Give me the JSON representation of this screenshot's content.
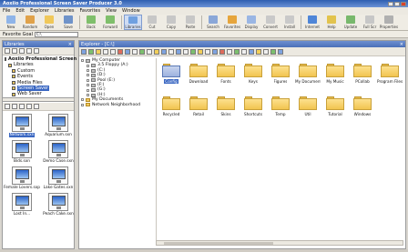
{
  "window": {
    "title": "Aoxiio Professional Screen Saver Producer 3.0"
  },
  "menu": [
    "File",
    "Edit",
    "Explorer",
    "Libraries",
    "Favorites",
    "View",
    "Window"
  ],
  "toolbar": [
    {
      "label": "New",
      "color": "#8fb4e8"
    },
    {
      "label": "Random",
      "color": "#e0a24a"
    },
    {
      "label": "Open",
      "color": "#f0c85a"
    },
    {
      "label": "Save",
      "color": "#6f93c9"
    },
    {
      "label": "Back",
      "color": "#7fbf6b"
    },
    {
      "label": "Forward",
      "color": "#7fbf6b"
    },
    {
      "label": "Libraries",
      "color": "#6fa0e0",
      "active": true
    },
    {
      "label": "Cut",
      "color": "#c7c7c7"
    },
    {
      "label": "Copy",
      "color": "#c7c7c7"
    },
    {
      "label": "Paste",
      "color": "#c7c7c7"
    },
    {
      "label": "Search",
      "color": "#8aa7d8"
    },
    {
      "label": "Favorites",
      "color": "#e6a53c"
    },
    {
      "label": "Display",
      "color": "#9ab6e4"
    },
    {
      "label": "Convert",
      "color": "#c9c9c9"
    },
    {
      "label": "Install",
      "color": "#c9c9c9"
    },
    {
      "label": "Internet",
      "color": "#4f86d8"
    },
    {
      "label": "Help",
      "color": "#e2c34d"
    },
    {
      "label": "Update",
      "color": "#78b86c"
    },
    {
      "label": "Full Scr",
      "color": "#c7c7c7"
    },
    {
      "label": "Properties",
      "color": "#b0b0b0"
    }
  ],
  "address": {
    "label": "Favorite Goal",
    "value": "C:\\"
  },
  "left_pane": {
    "title": "Libraries",
    "tree": [
      {
        "label": "Aoxiio Professional Screen Saver",
        "bold": true,
        "color": "#4f7ccc"
      },
      {
        "label": "Libraries",
        "color": "#f2c85e"
      },
      {
        "label": "Custom",
        "color": "#f2c85e"
      },
      {
        "label": "Events",
        "color": "#f2c85e"
      },
      {
        "label": "Media Files",
        "color": "#f2c85e"
      },
      {
        "label": "Screen Saver",
        "color": "#f2c85e",
        "selected": true
      },
      {
        "label": "Web Saver",
        "color": "#f2c85e"
      }
    ],
    "thumbnails": [
      {
        "caption": "Network.sxn",
        "selected": true
      },
      {
        "caption": "Aquarium.sxn"
      },
      {
        "caption": "Bids.sxn"
      },
      {
        "caption": "Demo Case.sxn"
      },
      {
        "caption": "Female Lovers.sxp"
      },
      {
        "caption": "Lake Gates.sxn"
      },
      {
        "caption": "Lost In..."
      },
      {
        "caption": "Peach Cake.sxn"
      }
    ]
  },
  "right_pane": {
    "title": "Explorer - [C:\\]",
    "tree": [
      {
        "label": "My Computer",
        "icon": "drive",
        "indent": 0
      },
      {
        "label": "3.5 Floppy (A:)",
        "icon": "drive",
        "indent": 1
      },
      {
        "label": "(C:)",
        "icon": "drive",
        "indent": 1
      },
      {
        "label": "(D:)",
        "icon": "drive",
        "indent": 1
      },
      {
        "label": "Pool (E:)",
        "icon": "drive",
        "indent": 1
      },
      {
        "label": "(F:)",
        "icon": "drive",
        "indent": 1
      },
      {
        "label": "(G:)",
        "icon": "drive",
        "indent": 1
      },
      {
        "label": "(H:)",
        "icon": "drive",
        "indent": 1
      },
      {
        "label": "My Documents",
        "icon": "folder",
        "indent": 0
      },
      {
        "label": "Network Neighborhood",
        "icon": "folder",
        "indent": 0
      }
    ],
    "folders": [
      {
        "name": "Config",
        "selected": true
      },
      {
        "name": "Download"
      },
      {
        "name": "Fonts"
      },
      {
        "name": "Keys"
      },
      {
        "name": "Figures"
      },
      {
        "name": "My Documents"
      },
      {
        "name": "My Music"
      },
      {
        "name": "PCollab"
      },
      {
        "name": "Program Files"
      },
      {
        "name": "Recycled"
      },
      {
        "name": "Retail"
      },
      {
        "name": "Skins"
      },
      {
        "name": "Shortcuts"
      },
      {
        "name": "Temp"
      },
      {
        "name": "Util"
      },
      {
        "name": "Tutorial"
      },
      {
        "name": "Windows"
      }
    ]
  }
}
